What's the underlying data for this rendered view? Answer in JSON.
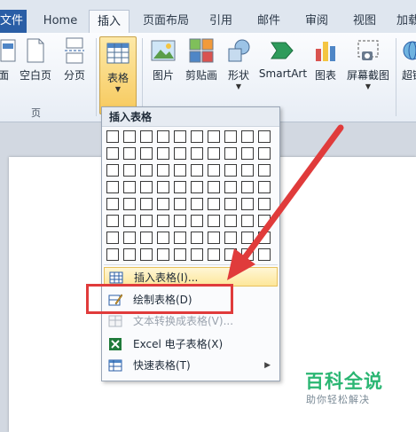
{
  "tabs": {
    "file": "文件",
    "home": "Home",
    "insert": "插入",
    "layout": "页面布局",
    "references": "引用",
    "mailings": "邮件",
    "review": "审阅",
    "view": "视图",
    "addins": "加载"
  },
  "ribbon": {
    "cover": "面",
    "blank_page": "空白页",
    "page_break": "分页",
    "table": "表格",
    "picture": "图片",
    "clipart": "剪贴画",
    "shapes": "形状",
    "smartart": "SmartArt",
    "chart": "图表",
    "screenshot": "屏幕截图",
    "hyperlink": "超链",
    "group_pages": "页"
  },
  "menu": {
    "header": "插入表格",
    "items": [
      {
        "label": "插入表格(I)...",
        "icon": "insert-table-icon",
        "state": "hover"
      },
      {
        "label": "绘制表格(D)",
        "icon": "draw-table-icon",
        "state": "normal"
      },
      {
        "label": "文本转换成表格(V)...",
        "icon": "text-to-table-icon",
        "state": "disabled"
      },
      {
        "label": "Excel 电子表格(X)",
        "icon": "excel-icon",
        "state": "normal"
      },
      {
        "label": "快速表格(T)",
        "icon": "quick-table-icon",
        "state": "normal",
        "submenu": true
      }
    ]
  },
  "watermark": {
    "title": "百科全说",
    "subtitle": "助你轻松解决"
  },
  "colors": {
    "accent_blue": "#2a5ea6",
    "highlight_yellow": "#fde79a",
    "annotation_red": "#e03b3b",
    "watermark_green": "#2bb673"
  }
}
